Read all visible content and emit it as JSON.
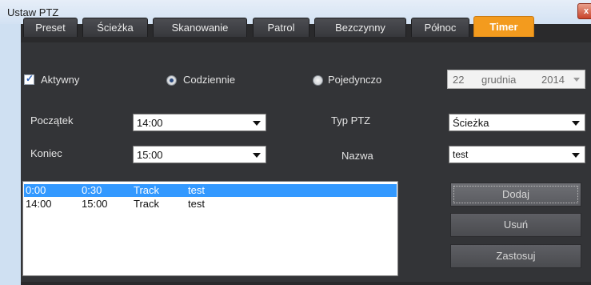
{
  "window": {
    "title": "Ustaw PTZ",
    "close_label": "x"
  },
  "tabs": [
    {
      "label": "Preset",
      "active": false
    },
    {
      "label": "Ścieżka",
      "active": false
    },
    {
      "label": "Skanowanie",
      "active": false
    },
    {
      "label": "Patrol",
      "active": false
    },
    {
      "label": "Bezczynny",
      "active": false
    },
    {
      "label": "Północ",
      "active": false
    },
    {
      "label": "Timer",
      "active": true
    }
  ],
  "options": {
    "active_label": "Aktywny",
    "active_checked": true,
    "daily_label": "Codziennie",
    "daily_selected": true,
    "single_label": "Pojedynczo",
    "single_selected": false
  },
  "date": {
    "day": "22",
    "month": "grudnia",
    "year": "2014"
  },
  "fields": {
    "start_label": "Początek",
    "start_value": "14:00",
    "end_label": "Koniec",
    "end_value": "15:00",
    "ptz_type_label": "Typ PTZ",
    "ptz_type_value": "Ścieżka",
    "name_label": "Nazwa",
    "name_value": "test"
  },
  "schedule": [
    {
      "start": "0:00",
      "end": "0:30",
      "type": "Track",
      "name": "test",
      "selected": true
    },
    {
      "start": "14:00",
      "end": "15:00",
      "type": "Track",
      "name": "test",
      "selected": false
    }
  ],
  "buttons": {
    "add": "Dodaj",
    "remove": "Usuń",
    "apply": "Zastosuj"
  },
  "colors": {
    "active_tab": "#f39b1e",
    "panel": "#333437",
    "selection": "#3399ff"
  }
}
